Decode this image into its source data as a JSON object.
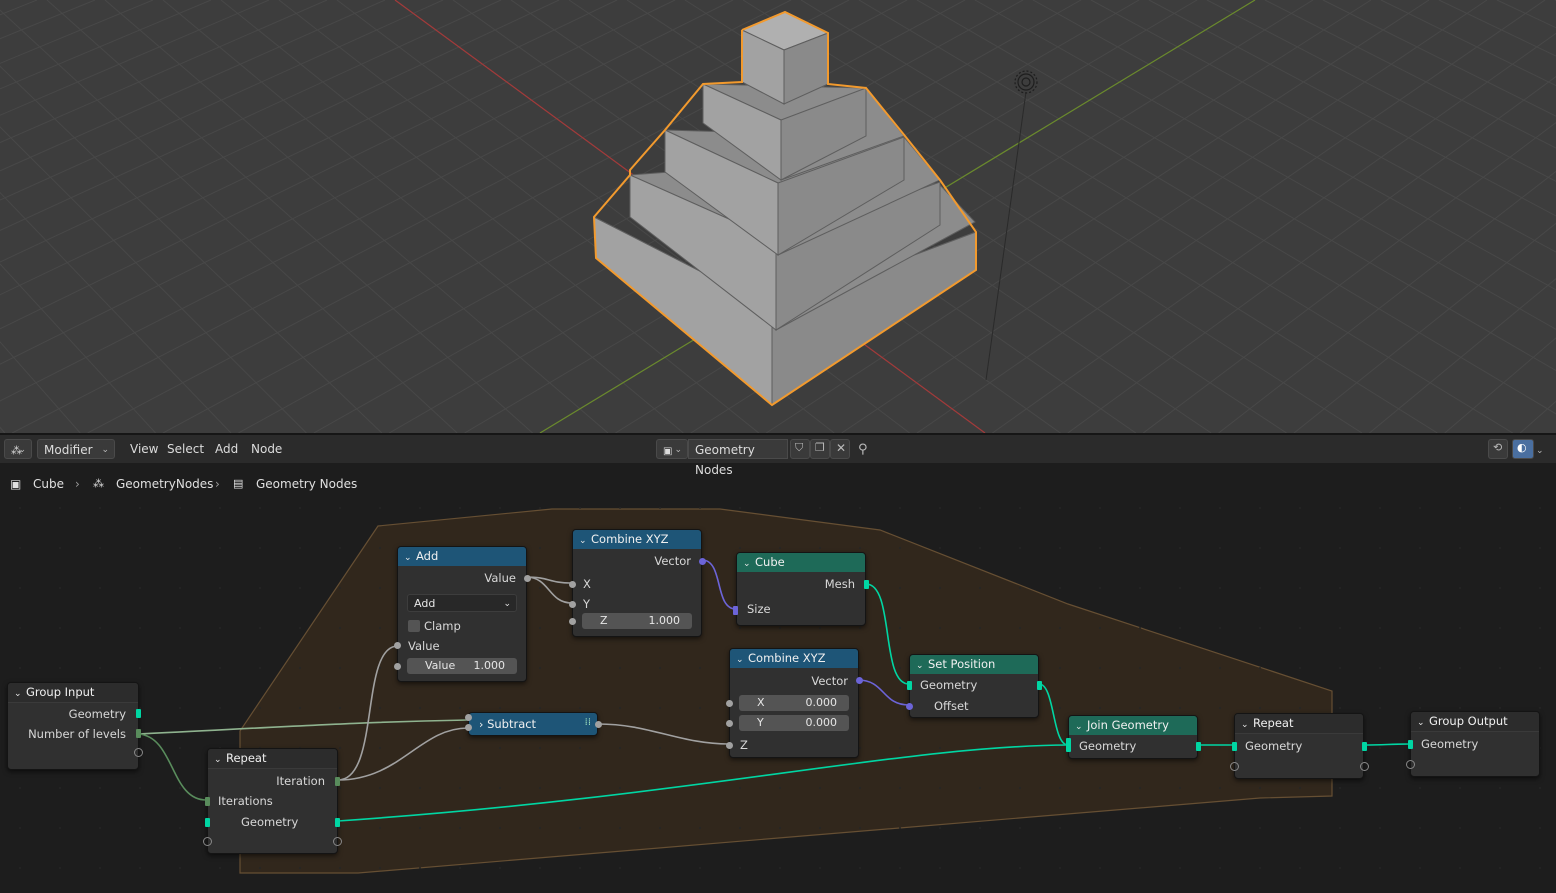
{
  "header": {
    "editor_mode": "Modifier",
    "menus": [
      "View",
      "Select",
      "Add",
      "Node"
    ],
    "node_tree_name": "Geometry Nodes"
  },
  "breadcrumb": {
    "object": "Cube",
    "modifier": "GeometryNodes",
    "node_group": "Geometry Nodes"
  },
  "nodes": {
    "group_input": {
      "title": "Group Input",
      "geometry": "Geometry",
      "levels": "Number of levels"
    },
    "add": {
      "title": "Add",
      "output": "Value",
      "operation": "Add",
      "clamp": "Clamp",
      "input": "Value",
      "field_label": "Value",
      "field_value": "1.000"
    },
    "combine1": {
      "title": "Combine XYZ",
      "output": "Vector",
      "x": "X",
      "y": "Y",
      "z_label": "Z",
      "z_value": "1.000"
    },
    "cube": {
      "title": "Cube",
      "output": "Mesh",
      "size": "Size"
    },
    "subtract": {
      "title": "Subtract"
    },
    "combine2": {
      "title": "Combine XYZ",
      "output": "Vector",
      "x_label": "X",
      "x_value": "0.000",
      "y_label": "Y",
      "y_value": "0.000",
      "z": "Z"
    },
    "set_position": {
      "title": "Set Position",
      "geometry": "Geometry",
      "offset": "Offset"
    },
    "join": {
      "title": "Join Geometry",
      "geometry": "Geometry"
    },
    "repeat_in": {
      "title": "Repeat",
      "iteration": "Iteration",
      "iterations": "Iterations",
      "geometry": "Geometry"
    },
    "repeat_out": {
      "title": "Repeat",
      "geometry": "Geometry"
    },
    "group_output": {
      "title": "Group Output",
      "geometry": "Geometry"
    }
  },
  "colors": {
    "geometry_socket": "#00d6a3",
    "vector_socket": "#6c64d8",
    "value_socket": "#a1a1a1",
    "integer_socket": "#598c5c",
    "selection_outline": "#f29a2e",
    "math_header": "#1e5577",
    "geometry_header": "#1e6a58"
  }
}
